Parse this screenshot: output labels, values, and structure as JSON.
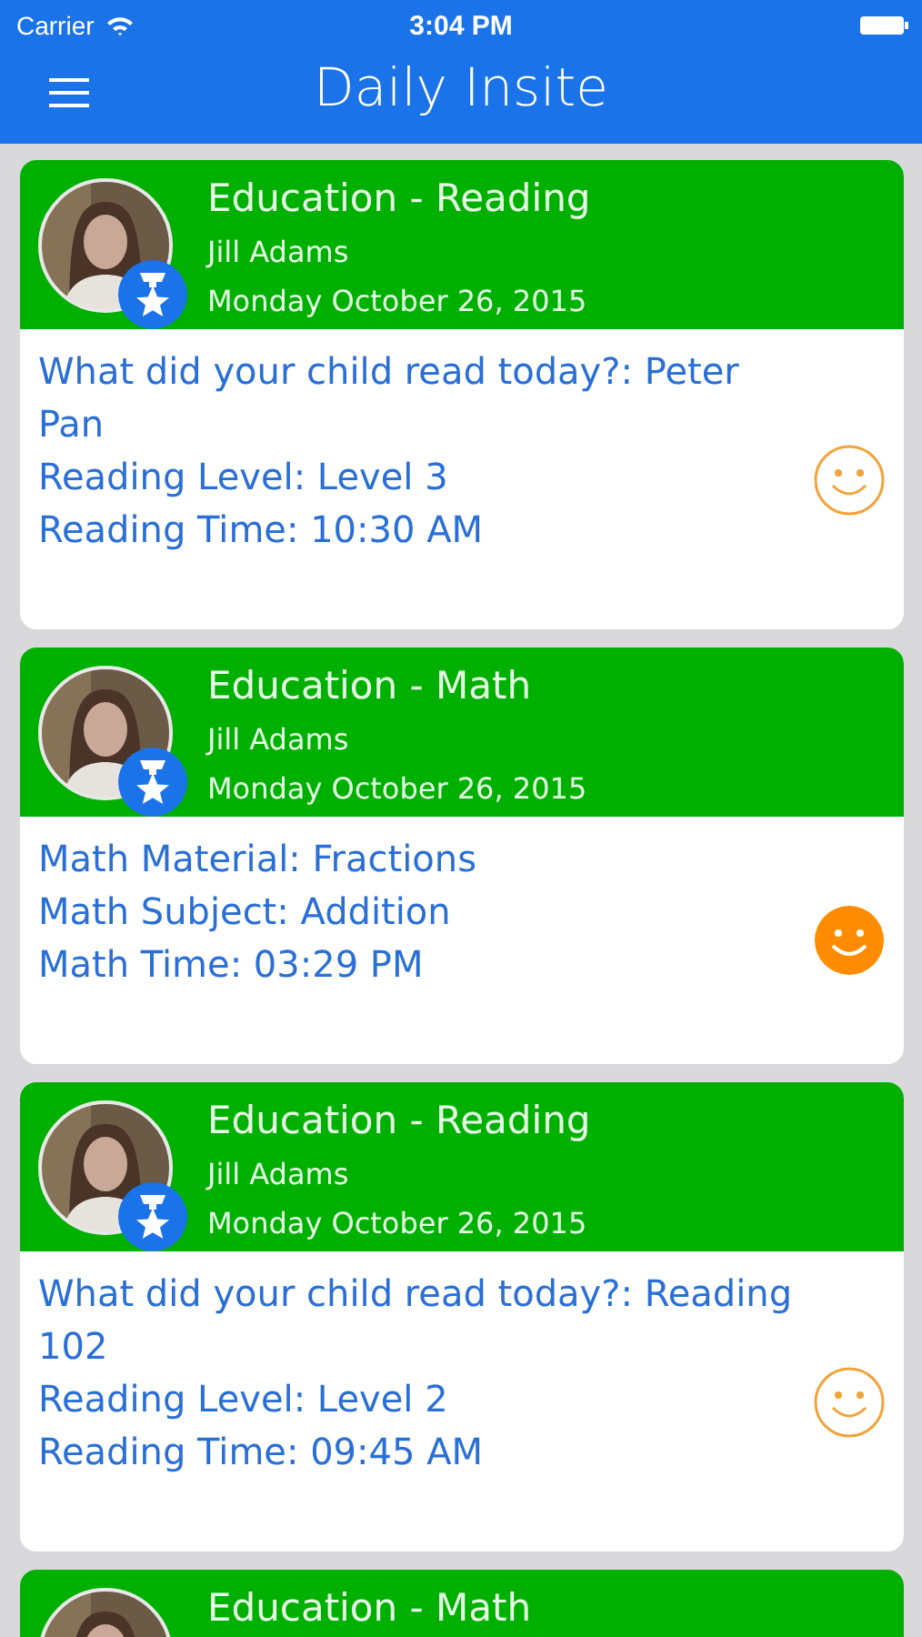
{
  "status_bar": {
    "carrier": "Carrier",
    "time": "3:04 PM"
  },
  "nav": {
    "title": "Daily Insite"
  },
  "cards": [
    {
      "title": "Education - Reading",
      "name": "Jill Adams",
      "date": "Monday October 26, 2015",
      "lines": [
        "What did your child read today?: Peter Pan",
        "Reading Level: Level 3",
        "Reading Time: 10:30 AM"
      ],
      "mood_filled": false
    },
    {
      "title": "Education - Math",
      "name": "Jill Adams",
      "date": "Monday October 26, 2015",
      "lines": [
        "Math Material: Fractions",
        "Math Subject: Addition",
        "Math Time: 03:29 PM"
      ],
      "mood_filled": true
    },
    {
      "title": "Education - Reading",
      "name": "Jill Adams",
      "date": "Monday October 26, 2015",
      "lines": [
        "What did your child read today?: Reading 102",
        "Reading Level: Level 2",
        "Reading Time: 09:45 AM"
      ],
      "mood_filled": false
    },
    {
      "title": "Education - Math"
    }
  ]
}
